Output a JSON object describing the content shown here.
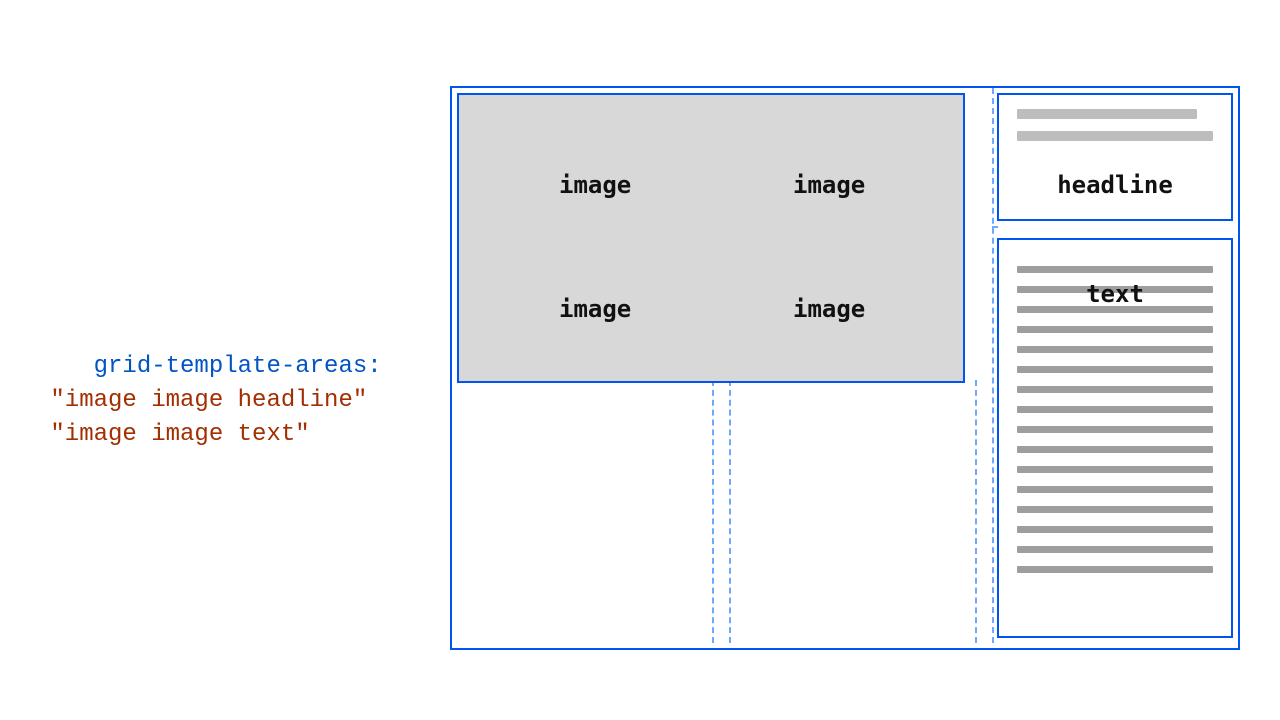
{
  "code": {
    "property": "grid-template-areas:",
    "line1": "\"image image headline\"",
    "line2": "\"image image text\""
  },
  "diagram": {
    "imageCell": "image",
    "headlineCell": "headline",
    "textCell": "text"
  }
}
